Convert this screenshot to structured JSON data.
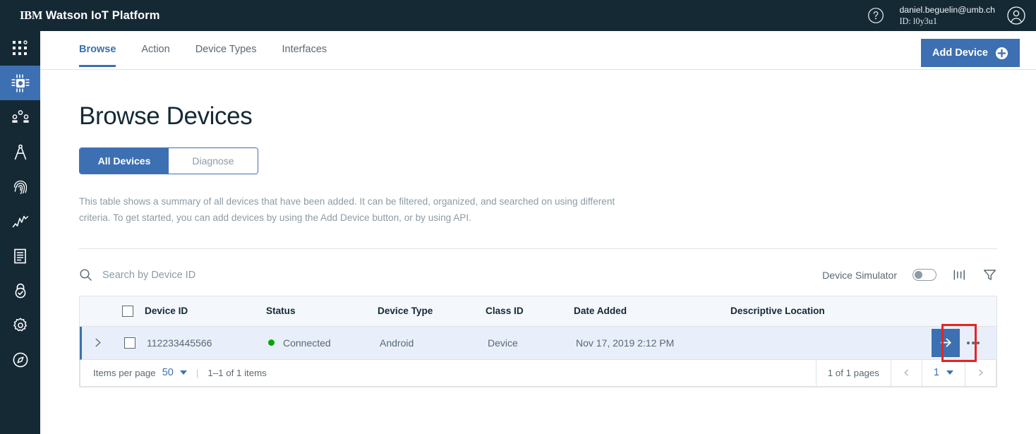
{
  "header": {
    "brand_ibm": "IBM",
    "brand_rest": "Watson IoT Platform",
    "help_icon": "help-circle-icon",
    "user_email": "daniel.beguelin@umb.ch",
    "user_id": "ID: l0y3u1",
    "avatar_icon": "user-avatar-icon"
  },
  "rail": {
    "items": [
      {
        "name": "app-switcher",
        "icon": "grid-apps-icon",
        "selected": false
      },
      {
        "name": "devices",
        "icon": "chip-icon",
        "selected": true
      },
      {
        "name": "members",
        "icon": "users-group-icon",
        "selected": false
      },
      {
        "name": "boards",
        "icon": "compass-drafting-icon",
        "selected": false
      },
      {
        "name": "security-identity",
        "icon": "fingerprint-icon",
        "selected": false
      },
      {
        "name": "analytics",
        "icon": "line-chart-icon",
        "selected": false
      },
      {
        "name": "logs",
        "icon": "document-list-icon",
        "selected": false
      },
      {
        "name": "access",
        "icon": "lock-check-icon",
        "selected": false
      },
      {
        "name": "settings",
        "icon": "gear-icon",
        "selected": false
      },
      {
        "name": "explore",
        "icon": "compass-circle-icon",
        "selected": false
      }
    ]
  },
  "tabs": [
    {
      "label": "Browse",
      "active": true
    },
    {
      "label": "Action",
      "active": false
    },
    {
      "label": "Device Types",
      "active": false
    },
    {
      "label": "Interfaces",
      "active": false
    }
  ],
  "add_device": {
    "label": "Add Device",
    "icon": "circle-plus-icon"
  },
  "page": {
    "title": "Browse Devices",
    "segments": [
      {
        "label": "All Devices",
        "active": true
      },
      {
        "label": "Diagnose",
        "active": false
      }
    ],
    "description": "This table shows a summary of all devices that have been added. It can be filtered, organized, and searched on using different criteria. To get started, you can add devices by using the Add Device button, or by using API."
  },
  "toolbar": {
    "search_placeholder": "Search by Device ID",
    "search_value": "",
    "search_icon": "search-icon",
    "simulator_label": "Device Simulator",
    "simulator_on": false,
    "columns_icon": "columns-icon",
    "filter_icon": "filter-funnel-icon"
  },
  "table": {
    "columns": [
      "Device ID",
      "Status",
      "Device Type",
      "Class ID",
      "Date Added",
      "Descriptive Location"
    ],
    "rows": [
      {
        "device_id": "112233445566",
        "status": "Connected",
        "status_color": "#00a800",
        "device_type": "Android",
        "class_id": "Device",
        "date_added": "Nov 17, 2019 2:12 PM",
        "descriptive_location": "",
        "expand_icon": "chevron-right-icon",
        "action_icon": "arrow-right-icon",
        "overflow_icon": "overflow-menu-icon"
      }
    ]
  },
  "pagination": {
    "items_per_page_label": "Items per page",
    "items_per_page_value": "50",
    "range_text": "1–1 of 1 items",
    "pages_text": "1 of 1 pages",
    "current_page": "1",
    "prev_icon": "chevron-left-icon",
    "next_icon": "chevron-right-icon"
  },
  "colors": {
    "brand_dark": "#152935",
    "accent_blue": "#3d70b2",
    "annotation_red": "#e52525",
    "status_green": "#00a800"
  }
}
